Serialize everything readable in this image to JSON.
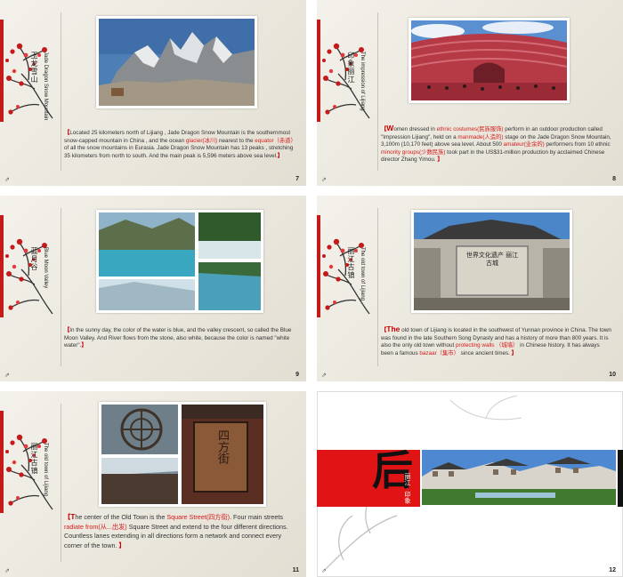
{
  "slides": [
    {
      "num": "7",
      "title_cn": "玉龙雪山",
      "title_en": "Jade Dragon Snow Mountain",
      "caption": {
        "open": "【",
        "p1": "Located 25 kilometers north of Lijiang , Jade Dragon  Snow Mountain is the southernmost snow-capped mountain in China , and the ocean ",
        "h1": "glacier(冰川)",
        "p2": " nearest to the ",
        "h2": "equator（赤道）",
        "p3": " of all the snow mountains in Eurasia. Jade Dragon Snow Mountain has 13 peaks , stretching 35 kilometers from north to south. And the main peak  is 5,596 meters above sea level.",
        "close": "】"
      }
    },
    {
      "num": "8",
      "title_cn": "印象丽江",
      "title_en": "The impression of Lijiang",
      "caption": {
        "open": "【",
        "first": "W",
        "p1": "omen dressed in ",
        "h1": "ethnic costumes(民族服饰)",
        "p2": " perform in an outdoor production called \"Impression Lijiang\", held on a ",
        "h2": "manmade(人造的)",
        "p3": " stage on the Jade Dragon Snow Mountain, 3,100m (10,170 feet) above sea level. About 500 ",
        "h3": "amateur(业余的)",
        "p4": " performers from 10 ethnic ",
        "h4": "minority groups(少数民族)",
        "p5": " took part in the US$31-million production by acclaimed Chinese director Zhang Yimou. ",
        "close": "】"
      }
    },
    {
      "num": "9",
      "title_cn": "蓝月谷",
      "title_en": "Blue Moon Valley",
      "caption": {
        "open": "【",
        "p1": "In the sunny day, the color of the water is blue, and the valley crescent, so called the Blue Moon Valley. And River flows from the stone, also white, because the color is named \"white water\".",
        "close": "】"
      }
    },
    {
      "num": "10",
      "title_cn": "丽江古镇",
      "title_en": "The old town of Lijiang",
      "caption": {
        "open": "【",
        "first": "The",
        "p1": " old town of Lijiang is located in the southwest of Yunnan province in China. The town was found in the late Southern Song Dynasty and has a history of more than 800 years. It is also the only old town without ",
        "h1": "protecting walls （城墙）",
        "p2": " in Chinese history. It has always been a famous ",
        "h2": "bazaar（集市）",
        "p3": " since ancient times. ",
        "close": "】"
      },
      "gate_text": "世界文化遗产 丽江古城"
    },
    {
      "num": "11",
      "title_cn": "丽江古镇",
      "title_en": "The old town of Lijiang",
      "caption": {
        "open": "【",
        "first": "T",
        "p1": "he center of the Old Town is the ",
        "h1": "Square Street(四方街)",
        "p2": ". Four main streets ",
        "h2": "radiate from(从...出发)",
        "p3": " Square Street and extend to the four different directions. Countless lanes extending in all directions form a network and connect every corner of the town. ",
        "close": "】"
      },
      "sign_text": "四方街"
    },
    {
      "num": "12",
      "big_char": "后",
      "sub_cn": "丽江 · 印象"
    }
  ],
  "share_icon_glyph": "⇗",
  "colors": {
    "accent": "#c41a1a",
    "highlight": "#d61c1c",
    "paper": "#ece9e0"
  }
}
